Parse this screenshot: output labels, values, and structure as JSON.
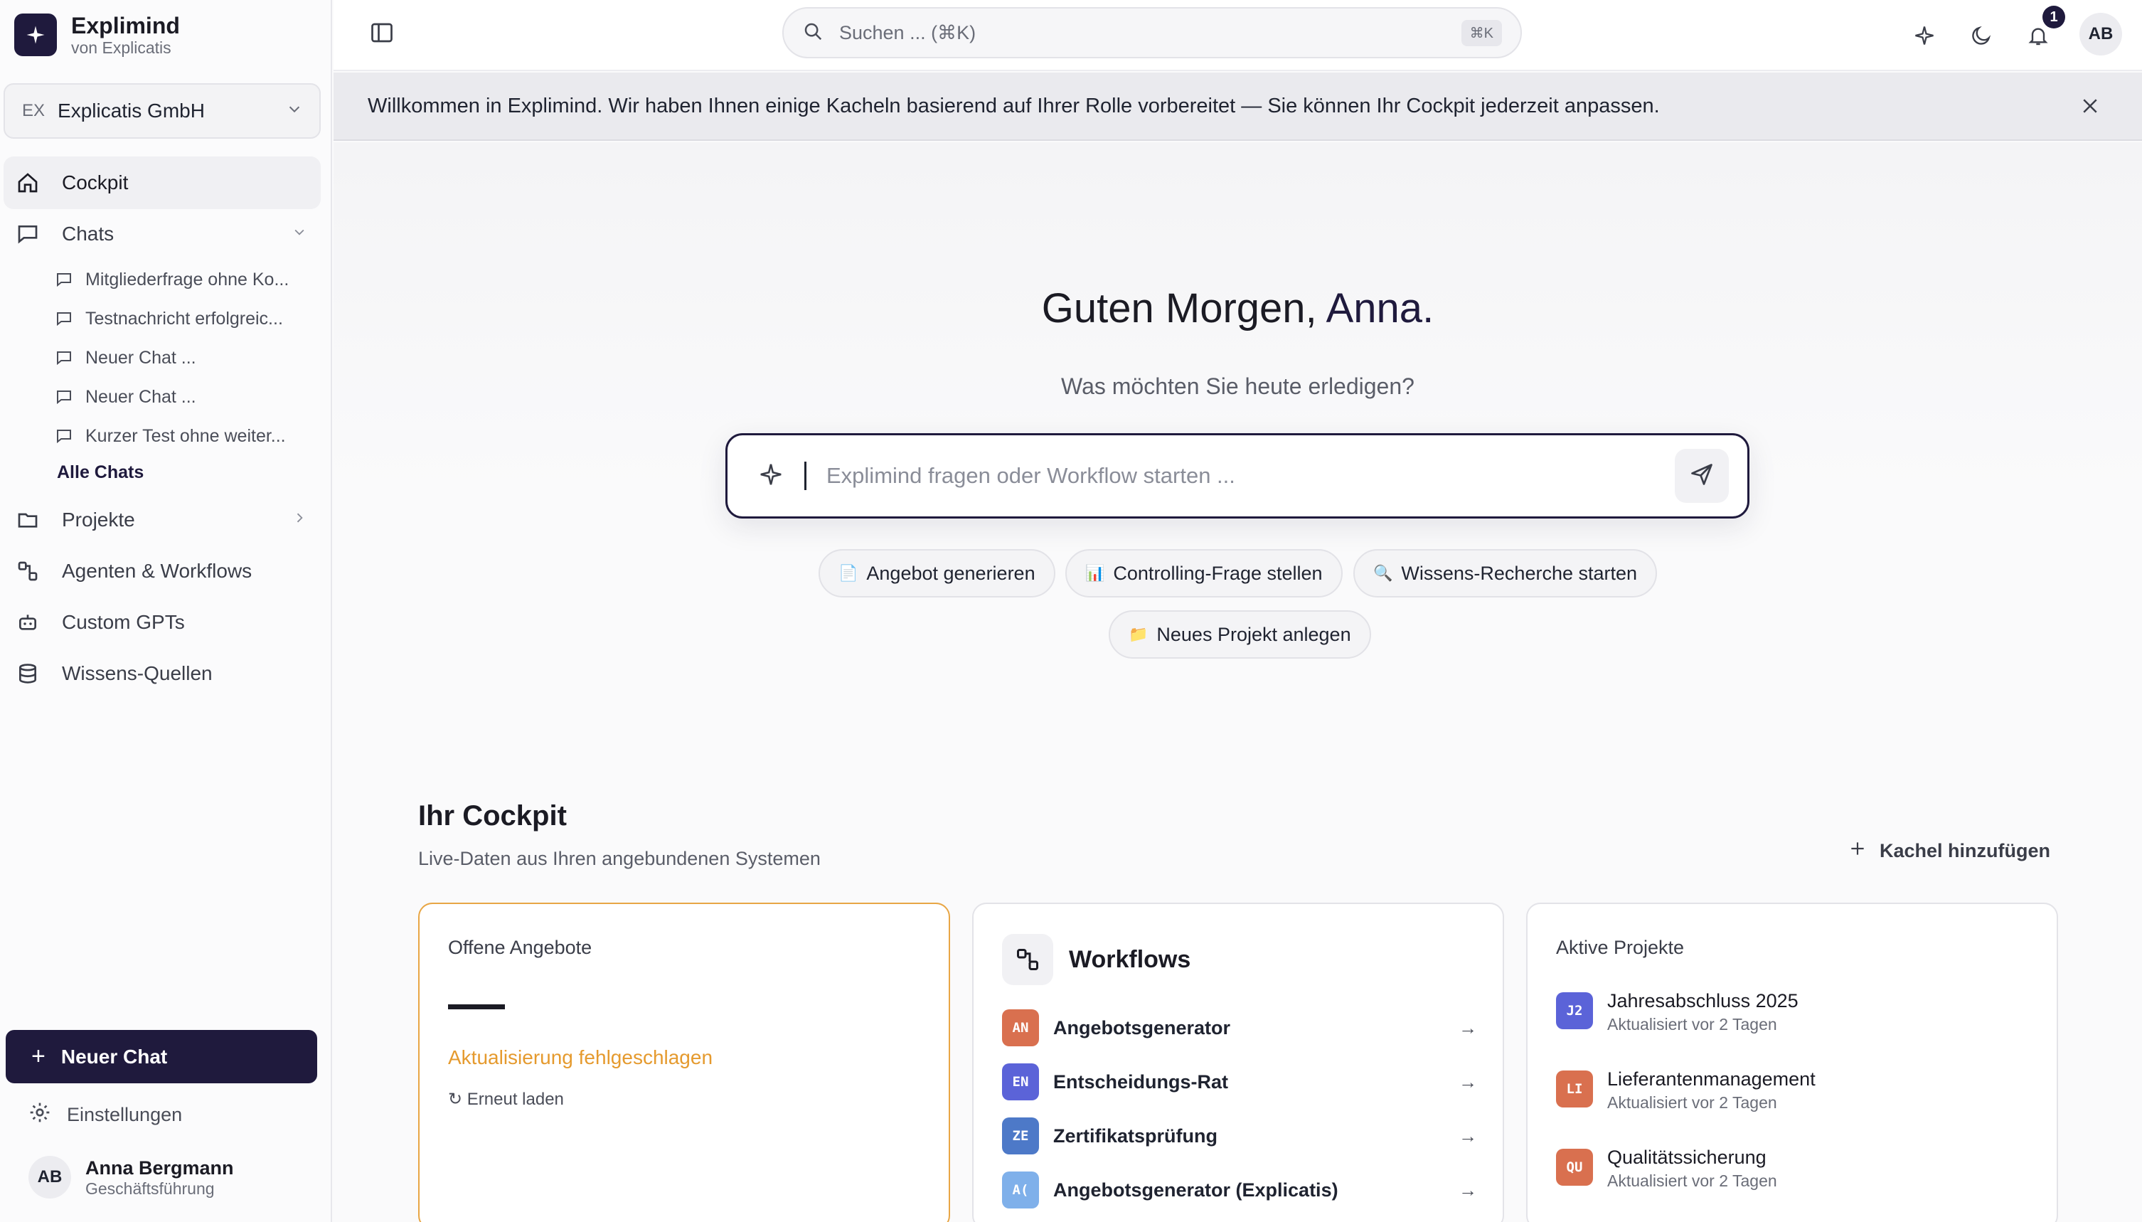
{
  "brand": {
    "title": "Explimind",
    "subtitle": "von Explicatis"
  },
  "org": {
    "badge": "EX",
    "name": "Explicatis GmbH"
  },
  "nav": {
    "cockpit": "Cockpit",
    "chats": "Chats",
    "chat_items": [
      "Mitgliederfrage ohne Ko...",
      "Testnachricht erfolgreic...",
      "Neuer Chat ...",
      "Neuer Chat ...",
      "Kurzer Test ohne weiter..."
    ],
    "all_chats": "Alle Chats",
    "projects": "Projekte",
    "agents": "Agenten & Workflows",
    "custom_gpts": "Custom GPTs",
    "knowledge": "Wissens-Quellen"
  },
  "new_chat": "Neuer Chat",
  "settings": "Einstellungen",
  "user": {
    "initials": "AB",
    "name": "Anna Bergmann",
    "role": "Geschäftsführung"
  },
  "topbar": {
    "search_placeholder": "Suchen ... (⌘K)",
    "search_shortcut": "⌘K",
    "notification_count": "1",
    "avatar_initials": "AB"
  },
  "banner": {
    "text": "Willkommen in Explimind. Wir haben Ihnen einige Kacheln basierend auf Ihrer Rolle vorbereitet — Sie können Ihr Cockpit jederzeit anpassen."
  },
  "hero": {
    "greeting_prefix": "Guten Morgen,",
    "greeting_name": "Anna.",
    "subtitle": "Was möchten Sie heute erledigen?",
    "prompt_placeholder": "Explimind fragen oder Workflow starten ..."
  },
  "chips": [
    {
      "emoji": "📄",
      "label": "Angebot generieren"
    },
    {
      "emoji": "📊",
      "label": "Controlling-Frage stellen"
    },
    {
      "emoji": "🔍",
      "label": "Wissens-Recherche starten"
    },
    {
      "emoji": "📁",
      "label": "Neues Projekt anlegen"
    }
  ],
  "cockpit": {
    "title": "Ihr Cockpit",
    "subtitle": "Live-Daten aus Ihren angebundenen Systemen",
    "add_tile": "Kachel hinzufügen"
  },
  "offers_card": {
    "title": "Offene Angebote",
    "error": "Aktualisierung fehlgeschlagen",
    "reload": "Erneut laden"
  },
  "workflows_card": {
    "title": "Workflows",
    "items": [
      {
        "abbr": "AN",
        "name": "Angebotsgenerator",
        "color": "#d9704f"
      },
      {
        "abbr": "EN",
        "name": "Entscheidungs-Rat",
        "color": "#5b63d8"
      },
      {
        "abbr": "ZE",
        "name": "Zertifikatsprüfung",
        "color": "#4d79c8"
      },
      {
        "abbr": "A(",
        "name": "Angebotsgenerator (Explicatis)",
        "color": "#7fb0ea"
      }
    ]
  },
  "projects_card": {
    "title": "Aktive Projekte",
    "items": [
      {
        "abbr": "J2",
        "name": "Jahresabschluss 2025",
        "updated": "Aktualisiert vor 2 Tagen",
        "color": "#5b63d8"
      },
      {
        "abbr": "LI",
        "name": "Lieferantenmanagement",
        "updated": "Aktualisiert vor 2 Tagen",
        "color": "#d9704f"
      },
      {
        "abbr": "QU",
        "name": "Qualitätssicherung",
        "updated": "Aktualisiert vor 2 Tagen",
        "color": "#d9704f"
      }
    ]
  },
  "colors": {
    "brand": "#1f1a3d",
    "warning": "#e59a2e"
  }
}
